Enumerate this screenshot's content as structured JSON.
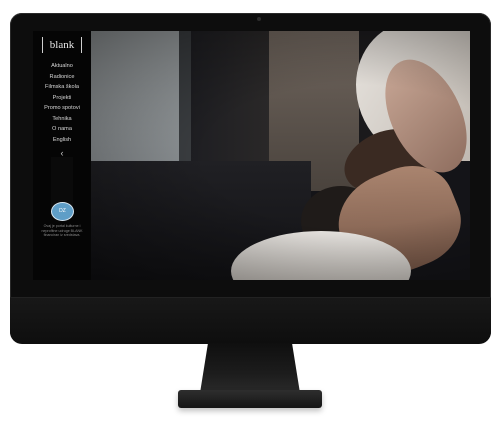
{
  "site": {
    "logo_text": "blank"
  },
  "nav": {
    "items": [
      {
        "label": "Aktualno"
      },
      {
        "label": "Radionice"
      },
      {
        "label": "Filmska škola"
      },
      {
        "label": "Projekti"
      },
      {
        "label": "Promo spotovi"
      },
      {
        "label": "Tehnika"
      },
      {
        "label": "O nama"
      },
      {
        "label": "English"
      }
    ],
    "collapse_symbol": "‹"
  },
  "sidebar": {
    "badge_text": "DZ",
    "fund_text": "Ovaj je portal kulturne i neprofitne udruge BLANK financiran iz sredstava."
  },
  "colors": {
    "screen_bg": "#000000",
    "badge": "#5f9ec7",
    "frame": "#0d0d0d"
  }
}
